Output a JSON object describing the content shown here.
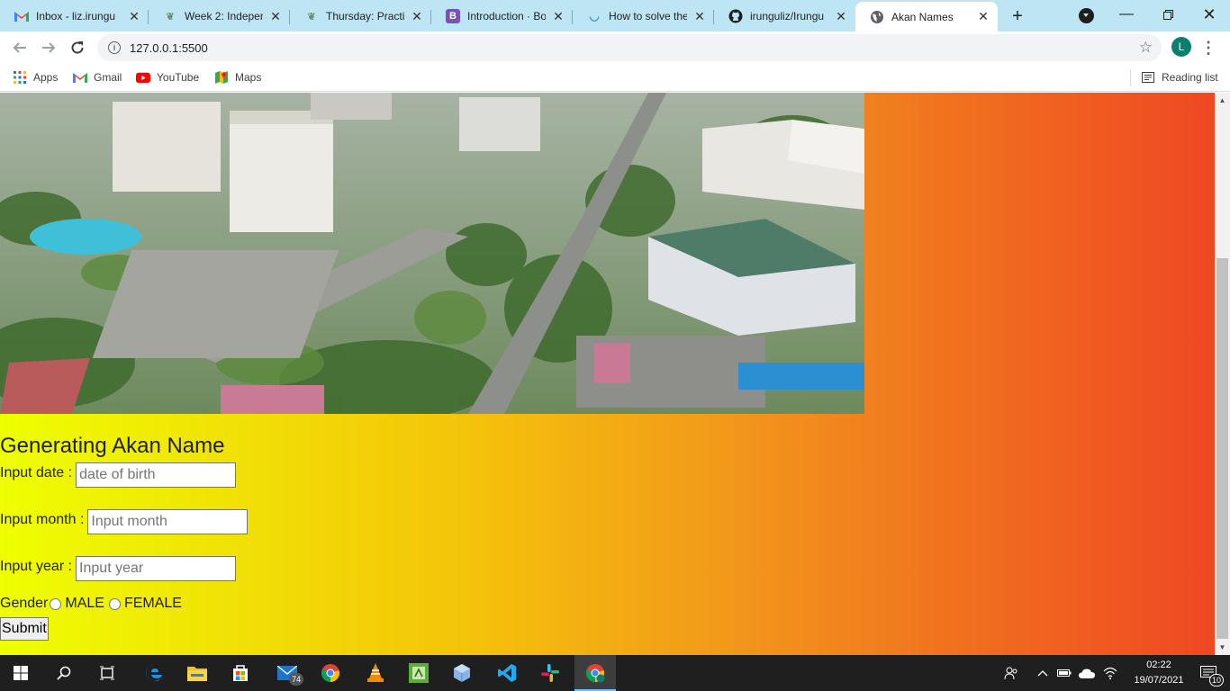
{
  "browser": {
    "tabs": [
      {
        "title": "Inbox - liz.irungu",
        "favicon": "gmail-icon"
      },
      {
        "title": "Week 2: Independ",
        "favicon": "moringa-icon"
      },
      {
        "title": "Thursday: Practic",
        "favicon": "moringa-icon"
      },
      {
        "title": "Introduction · Boo",
        "favicon": "bootstrap-icon"
      },
      {
        "title": "How to solve the",
        "favicon": "stackoverflow-icon"
      },
      {
        "title": "irunguliz/Irungu",
        "favicon": "github-icon"
      },
      {
        "title": "Akan Names",
        "favicon": "globe-icon",
        "active": true
      }
    ],
    "url": "127.0.0.1:5500",
    "profile_initial": "L",
    "bookmarks": [
      {
        "label": "Apps",
        "icon": "apps-grid-icon"
      },
      {
        "label": "Gmail",
        "icon": "gmail-icon"
      },
      {
        "label": "YouTube",
        "icon": "youtube-icon"
      },
      {
        "label": "Maps",
        "icon": "maps-icon"
      }
    ],
    "reading_list": "Reading list"
  },
  "page": {
    "hero_image": "city aerial photograph",
    "heading": "Generating Akan Name",
    "fields": [
      {
        "label": "Input date :",
        "placeholder": "date of birth",
        "value": ""
      },
      {
        "label": "Input month :",
        "placeholder": "Input month",
        "value": ""
      },
      {
        "label": "Input year :",
        "placeholder": "Input year",
        "value": ""
      }
    ],
    "gender_label": "Gender",
    "gender_options": [
      "MALE",
      "FEMALE"
    ],
    "submit_label": "Submit"
  },
  "taskbar": {
    "mail_badge": "74",
    "time": "02:22",
    "date": "19/07/2021",
    "notification_count": "10"
  },
  "colors": {
    "tabstrip_bg": "#bde5f4",
    "gradient_start": "#eeff00",
    "gradient_end": "#ef4823",
    "taskbar_bg": "#1f1f1f"
  }
}
